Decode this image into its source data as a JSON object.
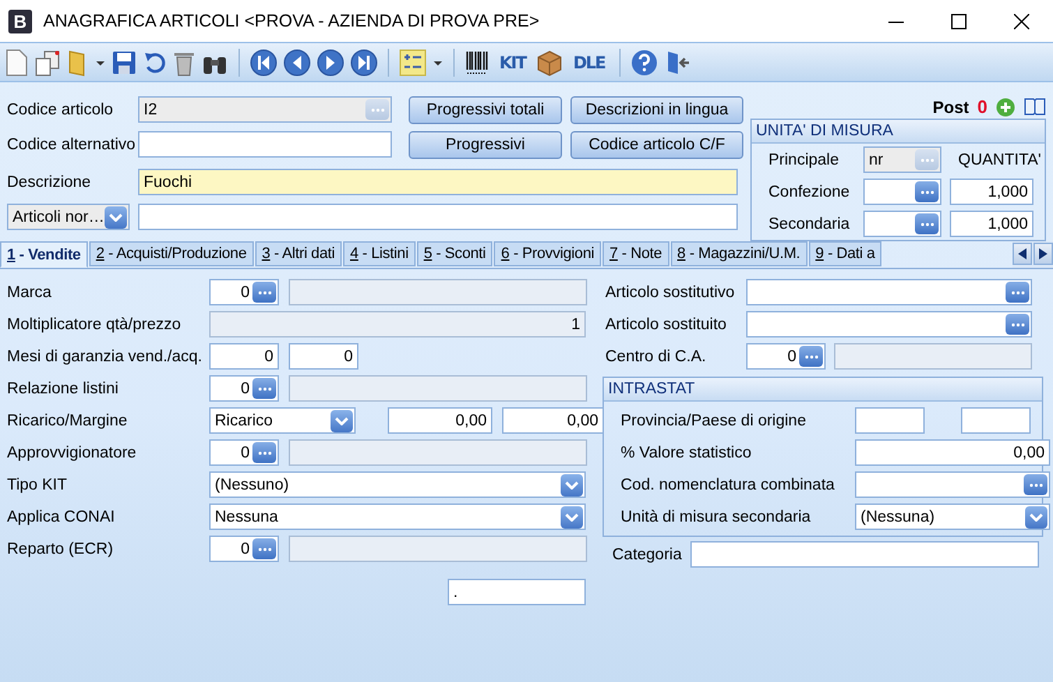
{
  "window": {
    "title": "ANAGRAFICA ARTICOLI <PROVA - AZIENDA DI PROVA PRE>",
    "app_letter": "B"
  },
  "toolbar": {
    "kit_label": "KIT",
    "dle_label": "DLE"
  },
  "header": {
    "fields": [
      {
        "label": "Codice articolo",
        "value": "I2",
        "kind": "lookup",
        "disabled": true,
        "focused": false
      },
      {
        "label": "Codice alternativo",
        "kind": "text",
        "disabled": false,
        "focused": false
      },
      {
        "label": "Descrizione",
        "value": "Fuochi",
        "kind": "text",
        "disabled": false,
        "focused": true
      }
    ],
    "buttons": [
      "Progressivi totali",
      "Descrizioni in lingua",
      "Progressivi",
      "Codice articolo C/F"
    ],
    "filter": {
      "value": "Articoli nor…"
    },
    "post": {
      "label": "Post",
      "count": "0"
    },
    "units": {
      "title": "UNITA' DI MISURA",
      "quantity_header": "QUANTITA'",
      "rows": [
        {
          "label": "Principale",
          "unit": "nr",
          "disabled": true
        },
        {
          "label": "Confezione",
          "quantity": "1,000",
          "disabled": false
        },
        {
          "label": "Secondaria",
          "quantity": "1,000",
          "disabled": false
        }
      ]
    }
  },
  "tabs": [
    {
      "key": "1",
      "label": "- Vendite",
      "selected": true
    },
    {
      "key": "2",
      "label": "- Acquisti/Produzione",
      "selected": false
    },
    {
      "key": "3",
      "label": "- Altri dati",
      "selected": false
    },
    {
      "key": "4",
      "label": "- Listini",
      "selected": false
    },
    {
      "key": "5",
      "label": "- Sconti",
      "selected": false
    },
    {
      "key": "6",
      "label": "- Provvigioni",
      "selected": false
    },
    {
      "key": "7",
      "label": "- Note",
      "selected": false
    },
    {
      "key": "8",
      "label": "- Magazzini/U.M.",
      "selected": false
    },
    {
      "key": "9",
      "label": "- Dati a",
      "selected": false
    }
  ],
  "left_rows": [
    {
      "label": "Marca",
      "kind": "code_lookup",
      "value": "0"
    },
    {
      "label": "Moltiplicatore qtà/prezzo",
      "kind": "readonly",
      "value": "1"
    },
    {
      "label": "Mesi di garanzia vend./acq.",
      "kind": "pair",
      "values": [
        "0",
        "0"
      ]
    },
    {
      "label": "Relazione listini",
      "kind": "code_lookup",
      "value": "0"
    },
    {
      "label": "Ricarico/Margine",
      "kind": "combo_pair",
      "value": "Ricarico",
      "values": [
        "0,00",
        "0,00"
      ]
    },
    {
      "label": "Approvvigionatore",
      "kind": "code_lookup",
      "value": "0"
    },
    {
      "label": "Tipo KIT",
      "kind": "combo",
      "value": "(Nessuno)"
    },
    {
      "label": "Applica CONAI",
      "kind": "combo",
      "value": "Nessuna"
    },
    {
      "label": "Reparto (ECR)",
      "kind": "code_lookup",
      "value": "0"
    }
  ],
  "bottom_field": {
    "value": "."
  },
  "right_rows": [
    {
      "label": "Articolo sostitutivo",
      "kind": "lookup"
    },
    {
      "label": "Articolo sostituito",
      "kind": "lookup"
    },
    {
      "label": "Centro di C.A.",
      "kind": "code_lookup",
      "value": "0"
    }
  ],
  "intrastat": {
    "title": "INTRASTAT",
    "rows": [
      {
        "label": "Provincia/Paese di origine",
        "kind": "pair"
      },
      {
        "label": "% Valore statistico",
        "kind": "number",
        "value": "0,00"
      },
      {
        "label": "Cod. nomenclatura combinata",
        "kind": "lookup"
      },
      {
        "label": "Unità di misura secondaria",
        "kind": "combo",
        "value": "(Nessuna)"
      }
    ]
  },
  "categoria": {
    "label": "Categoria"
  }
}
